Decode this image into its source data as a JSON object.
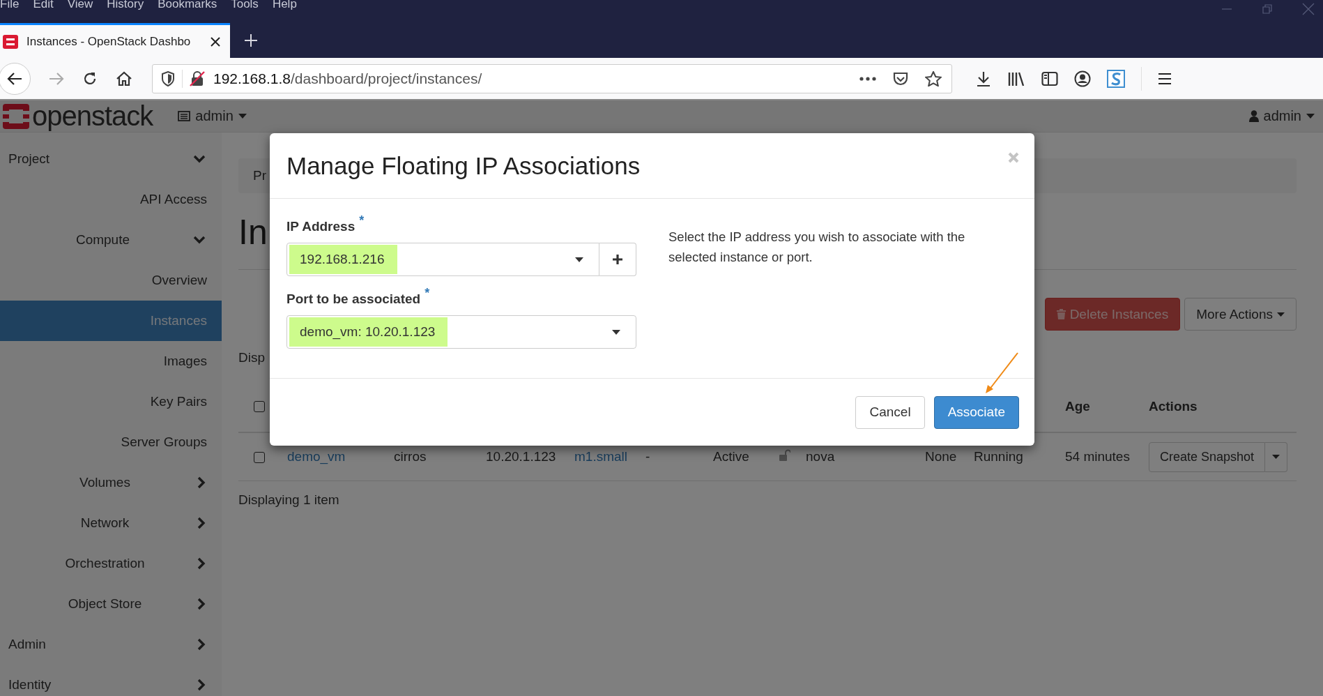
{
  "browser": {
    "menu": [
      "File",
      "Edit",
      "View",
      "History",
      "Bookmarks",
      "Tools",
      "Help"
    ],
    "tab": {
      "title": "Instances - OpenStack Dashbo",
      "selected": true
    },
    "url": {
      "host": "192.168.1.8",
      "path": "/dashboard/project/instances/"
    }
  },
  "header": {
    "logo": "openstack",
    "project_menu": "admin",
    "user_menu": "admin"
  },
  "sidebar": {
    "items": [
      {
        "label": "Project",
        "expanded": true,
        "selected": false,
        "children": [
          {
            "label": "API Access",
            "selected": false
          },
          {
            "label": "Compute",
            "expanded": true,
            "selected": false,
            "children": [
              {
                "label": "Overview",
                "selected": false
              },
              {
                "label": "Instances",
                "selected": true
              },
              {
                "label": "Images",
                "selected": false
              },
              {
                "label": "Key Pairs",
                "selected": false
              },
              {
                "label": "Server Groups",
                "selected": false
              }
            ]
          },
          {
            "label": "Volumes",
            "expanded": false,
            "selected": false
          },
          {
            "label": "Network",
            "expanded": false,
            "selected": false
          },
          {
            "label": "Orchestration",
            "expanded": false,
            "selected": false
          },
          {
            "label": "Object Store",
            "expanded": false,
            "selected": false
          }
        ]
      },
      {
        "label": "Admin",
        "expanded": false,
        "selected": false
      },
      {
        "label": "Identity",
        "expanded": false,
        "selected": false
      }
    ]
  },
  "page": {
    "breadcrumb": "Pr",
    "heading": "In",
    "display_count": "Disp",
    "buttons": [
      {
        "label": "Delete Instances",
        "kind": "danger"
      },
      {
        "label": "More Actions",
        "kind": "dropdown"
      }
    ],
    "table": {
      "header_checked": false,
      "columns": [
        "",
        "",
        "",
        "",
        "",
        "",
        "",
        "",
        "",
        "",
        "Age",
        "Actions"
      ],
      "rows": [
        {
          "checked": false,
          "cells": [
            {
              "kind": "link",
              "text": "demo_vm"
            },
            {
              "kind": "text",
              "text": "cirros"
            },
            {
              "kind": "text",
              "text": "10.20.1.123"
            },
            {
              "kind": "link",
              "text": "m1.small"
            },
            {
              "kind": "text",
              "text": "-"
            },
            {
              "kind": "text",
              "text": "Active"
            },
            {
              "kind": "lock"
            },
            {
              "kind": "text",
              "text": "nova"
            },
            {
              "kind": "text",
              "text": "None"
            },
            {
              "kind": "text",
              "text": "Running"
            },
            {
              "kind": "text",
              "text": "54 minutes"
            }
          ],
          "action": "Create Snapshot"
        }
      ]
    },
    "footer": "Displaying 1 item"
  },
  "modal": {
    "title": "Manage Floating IP Associations",
    "fields": [
      {
        "label": "IP Address",
        "required_mark": "*",
        "value": "192.168.1.216",
        "add_button": true
      },
      {
        "label": "Port to be associated",
        "required_mark": "*",
        "value": "demo_vm: 10.20.1.123",
        "add_button": false
      }
    ],
    "help": "Select the IP address you wish to associate with the selected instance or port.",
    "buttons": [
      {
        "label": "Cancel",
        "kind": "default"
      },
      {
        "label": "Associate",
        "kind": "primary"
      }
    ]
  }
}
